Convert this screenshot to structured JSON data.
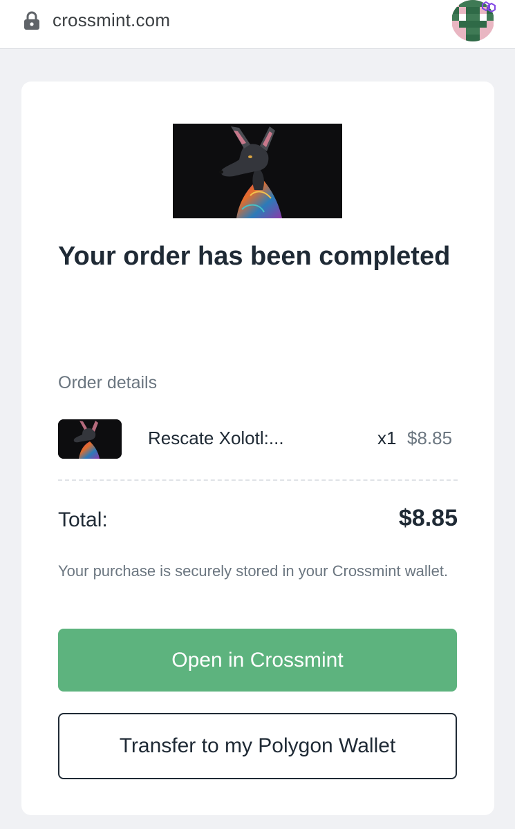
{
  "browser": {
    "url": "crossmint.com"
  },
  "colors": {
    "primary_button": "#5db37e",
    "text_dark": "#1f2a35",
    "text_muted": "#6b7680",
    "page_bg": "#f0f1f4"
  },
  "icons": {
    "lock": "lock-icon",
    "avatar": "pixel-avatar",
    "chain_badge": "polygon-icon"
  },
  "order": {
    "title": "Your order has been completed",
    "details_label": "Order details",
    "item": {
      "name": "Rescate Xolotl:...",
      "quantity": "x1",
      "price": "$8.85"
    },
    "total_label": "Total:",
    "total_value": "$8.85",
    "note": "Your purchase is securely stored in your Crossmint wallet."
  },
  "actions": {
    "open_label": "Open in Crossmint",
    "transfer_label": "Transfer to my Polygon Wallet"
  }
}
